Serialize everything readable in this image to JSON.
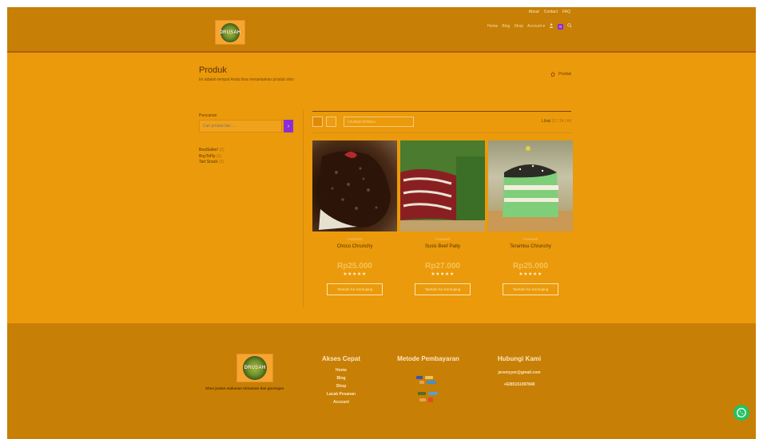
{
  "header": {
    "top_links": [
      "About",
      "Contact",
      "FAQ"
    ],
    "logo_text": "DRUSAH",
    "nav": [
      "Home",
      "Blog",
      "Shop",
      "Account"
    ],
    "cart_count": "0"
  },
  "page": {
    "title": "Produk",
    "subtitle": "Ini adalah tempat Anda bisa menjelaskan produk toko",
    "breadcrumb": "Produk"
  },
  "sidebar": {
    "search_label": "Pencarian",
    "search_placeholder": "Cari produk lain ...",
    "categories": [
      {
        "label": "BestSeller!",
        "count": "(2)"
      },
      {
        "label": "BuyToFly",
        "count": "(1)"
      },
      {
        "label": "Tart Snack",
        "count": "(3)"
      }
    ]
  },
  "toolbar": {
    "sort_label": "Urutkan terbaru",
    "show_label": "Lihat",
    "show_value": "12 / 24 / All"
  },
  "products": [
    {
      "category": "Featured",
      "name": "Choco Chrunchy",
      "price": "Rp25.000",
      "stars": "★★★★★",
      "button": "Tambah Ke Keranjang"
    },
    {
      "category": "Featured",
      "name": "Susis Beef Patty",
      "price": "Rp27.000",
      "stars": "★★★★★",
      "button": "Tambah Ke Keranjang"
    },
    {
      "category": "Featured",
      "name": "Teramisu Chrunchy",
      "price": "Rp25.000",
      "stars": "★★★★★",
      "button": "Tambah Ke Keranjang"
    }
  ],
  "footer": {
    "logo_text": "DRUSAH",
    "tagline": "Situs jualan makanan minuman dan gorengan",
    "akses": {
      "title": "Akses Cepat",
      "items": [
        "Home",
        "Blog",
        "Shop",
        "Lacak Pesanan",
        "Account"
      ]
    },
    "bayar": {
      "title": "Metode Pembayaran"
    },
    "kontak": {
      "title": "Hubungi Kami",
      "email": "jeremyysr@gmail.com",
      "phone": "+6285151997840"
    }
  },
  "colors": {
    "page_bg": "#ea9a0b",
    "header_bg": "#c77f05",
    "accent_purple": "#8a2fd6",
    "whatsapp": "#25c161"
  }
}
